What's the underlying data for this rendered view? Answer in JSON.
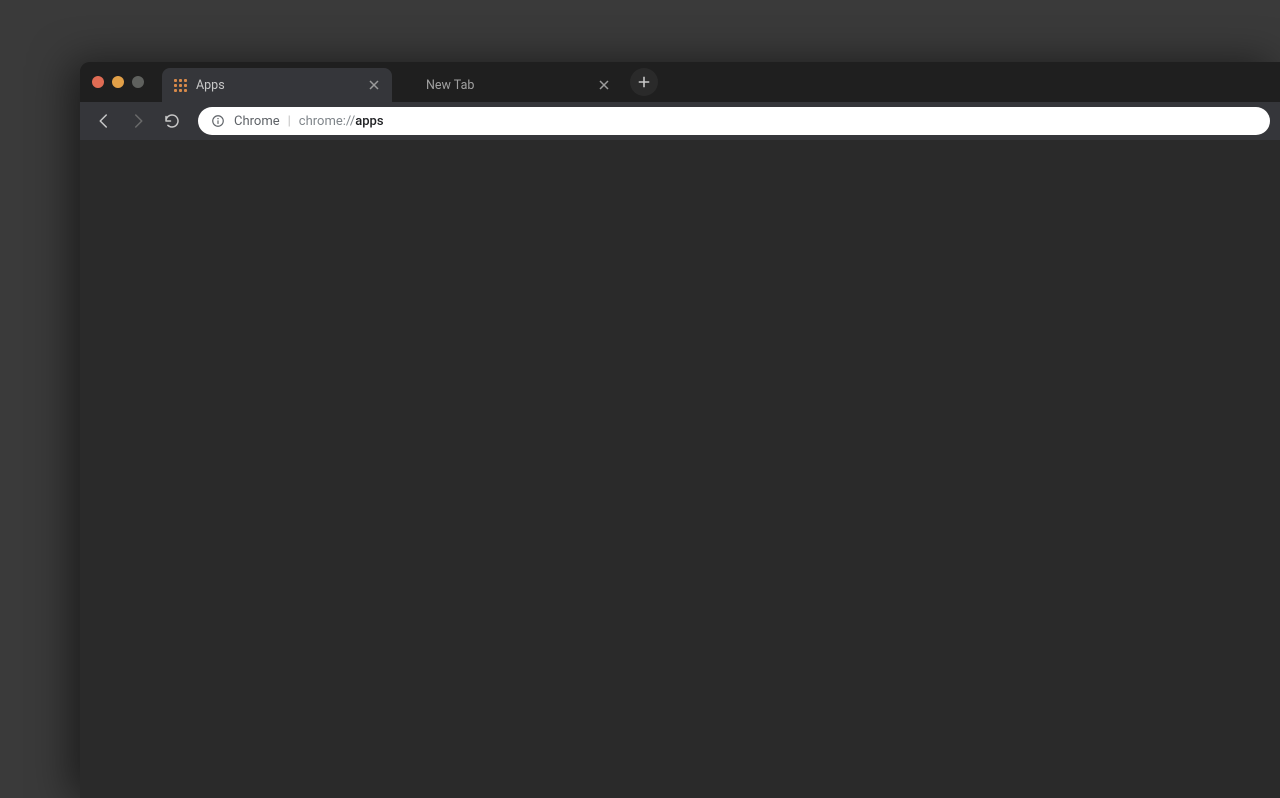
{
  "tabs": [
    {
      "title": "Apps",
      "active": true
    },
    {
      "title": "New Tab",
      "active": false
    }
  ],
  "address": {
    "origin_label": "Chrome",
    "scheme": "chrome://",
    "path": "apps"
  }
}
